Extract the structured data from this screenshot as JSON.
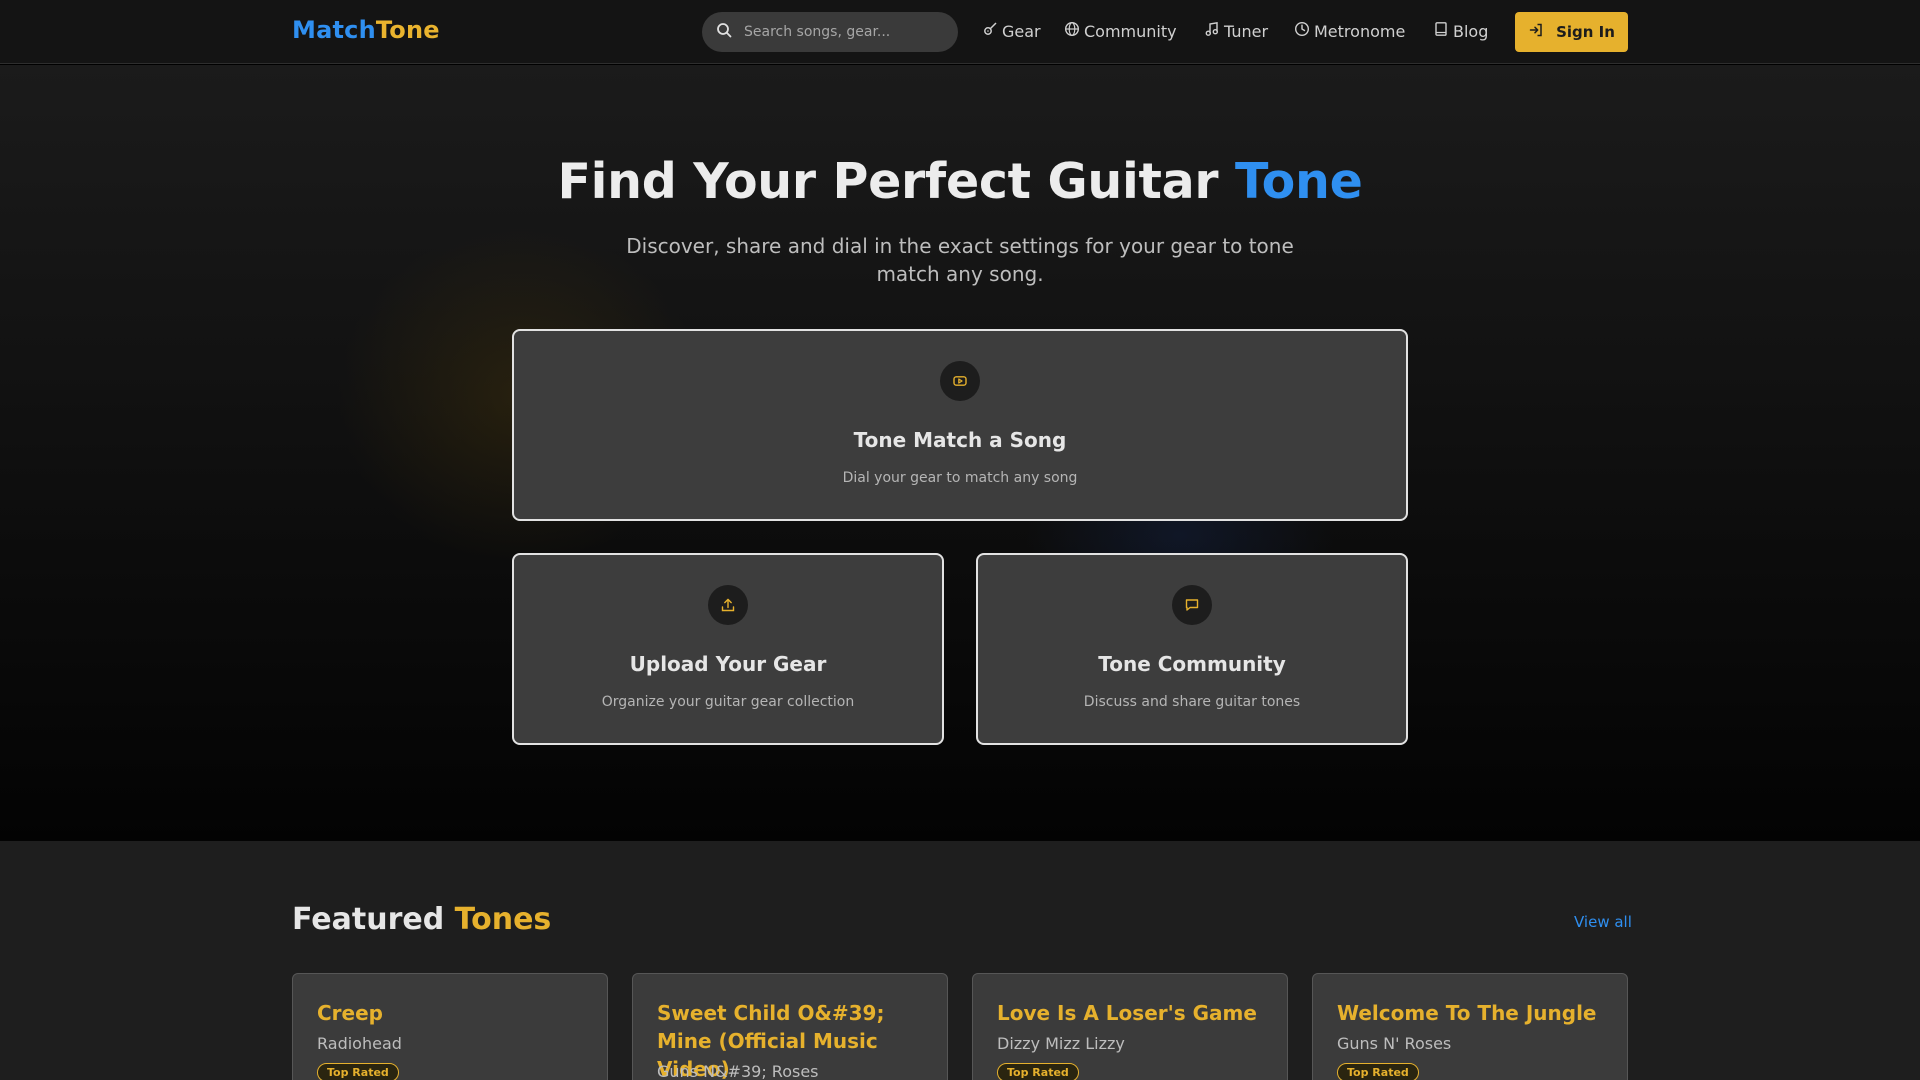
{
  "header": {
    "logo_part1": "Match",
    "logo_part2": "Tone",
    "search_placeholder": "Search songs, gear...",
    "nav": [
      {
        "label": "Gear",
        "icon": "guitar-icon"
      },
      {
        "label": "Community",
        "icon": "globe-icon"
      },
      {
        "label": "Tuner",
        "icon": "music-note-icon"
      },
      {
        "label": "Metronome",
        "icon": "clock-icon"
      },
      {
        "label": "Blog",
        "icon": "book-icon"
      }
    ],
    "signin_label": "Sign In"
  },
  "hero": {
    "title_main": "Find Your Perfect Guitar ",
    "title_accent": "Tone",
    "subtitle": "Discover, share and dial in the exact settings for your gear to tone match any song.",
    "cards": [
      {
        "title": "Tone Match a Song",
        "desc": "Dial your gear to match any song",
        "icon": "youtube-icon"
      },
      {
        "title": "Upload Your Gear",
        "desc": "Organize your guitar gear collection",
        "icon": "upload-icon"
      },
      {
        "title": "Tone Community",
        "desc": "Discuss and share guitar tones",
        "icon": "chat-icon"
      }
    ]
  },
  "featured": {
    "title_main": "Featured ",
    "title_accent": "Tones",
    "view_all": "View all",
    "tones": [
      {
        "song": "Creep",
        "artist": "Radiohead",
        "badge": "Top Rated"
      },
      {
        "song": "Sweet Child O&#39; Mine (Official Music Video)",
        "artist": "Guns N&#39; Roses",
        "badge": ""
      },
      {
        "song": "Love Is A Loser's Game",
        "artist": "Dizzy Mizz Lizzy",
        "badge": "Top Rated"
      },
      {
        "song": "Welcome To The Jungle",
        "artist": "Guns N' Roses",
        "badge": "Top Rated"
      }
    ]
  },
  "colors": {
    "blue_accent": "#2f8ff0",
    "gold_accent": "#e6b12d"
  }
}
